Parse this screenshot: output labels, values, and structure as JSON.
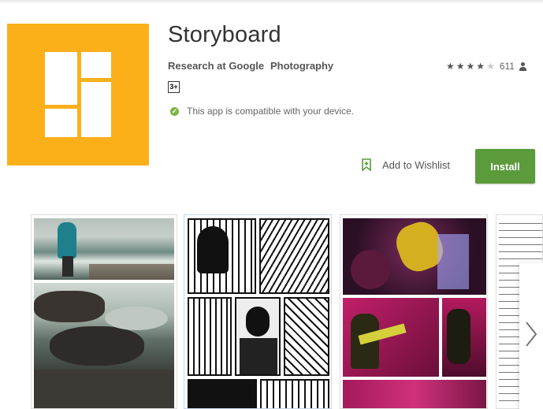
{
  "app": {
    "title": "Storyboard",
    "developer": "Research at Google",
    "category": "Photography",
    "rating_stars": 4,
    "rating_count": "611",
    "content_rating": "3+",
    "compatibility": "This app is compatible with your device.",
    "icon_color": "#FBB01A"
  },
  "actions": {
    "wishlist_label": "Add to Wishlist",
    "install_label": "Install",
    "install_color": "#5c9b3b"
  },
  "screenshots": {
    "count_visible": 4
  }
}
